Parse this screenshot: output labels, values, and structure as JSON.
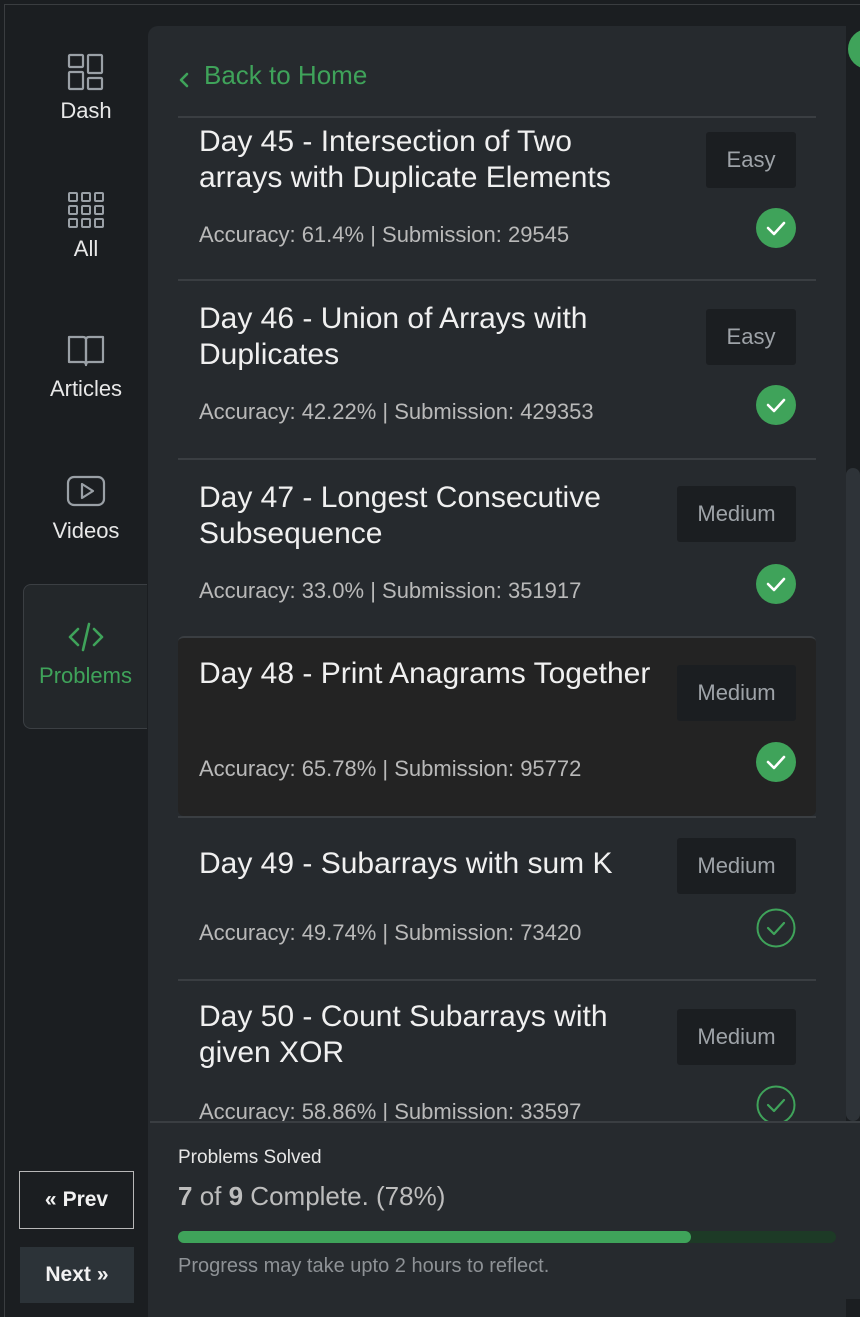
{
  "sidebar": {
    "items": [
      {
        "label": "Dash",
        "icon": "dashboard-icon"
      },
      {
        "label": "All",
        "icon": "grid-icon"
      },
      {
        "label": "Articles",
        "icon": "book-icon"
      },
      {
        "label": "Videos",
        "icon": "play-icon"
      },
      {
        "label": "Problems",
        "icon": "code-icon"
      }
    ],
    "prev_label": "Prev",
    "next_label": "Next"
  },
  "header": {
    "back_label": "Back to Home"
  },
  "problems": [
    {
      "title": "Day 45 - Intersection of Two arrays with Duplicate Elements",
      "meta": "Accuracy: 61.4% | Submission: 29545",
      "difficulty": "Easy",
      "solved": true
    },
    {
      "title": "Day 46 - Union of Arrays with Duplicates",
      "meta": "Accuracy: 42.22% | Submission: 429353",
      "difficulty": "Easy",
      "solved": true
    },
    {
      "title": "Day 47 - Longest Consecutive Subsequence",
      "meta": "Accuracy: 33.0% | Submission: 351917",
      "difficulty": "Medium",
      "solved": true
    },
    {
      "title": "Day 48 - Print Anagrams Together",
      "meta": "Accuracy: 65.78% | Submission: 95772",
      "difficulty": "Medium",
      "solved": true
    },
    {
      "title": "Day 49 - Subarrays with sum K",
      "meta": "Accuracy: 49.74% | Submission: 73420",
      "difficulty": "Medium",
      "solved": false
    },
    {
      "title": "Day 50 - Count Subarrays with given XOR",
      "meta": "Accuracy: 58.86% | Submission: 33597",
      "difficulty": "Medium",
      "solved": false
    }
  ],
  "footer": {
    "label": "Problems Solved",
    "solved": "7",
    "of_word": " of ",
    "total": "9",
    "suffix": " Complete. (78%)",
    "progress": 0.78,
    "note": "Progress may take upto 2 hours to reflect."
  },
  "colors": {
    "accent": "#3fa35a",
    "panel": "#262a2e",
    "background": "#1b1e21"
  }
}
